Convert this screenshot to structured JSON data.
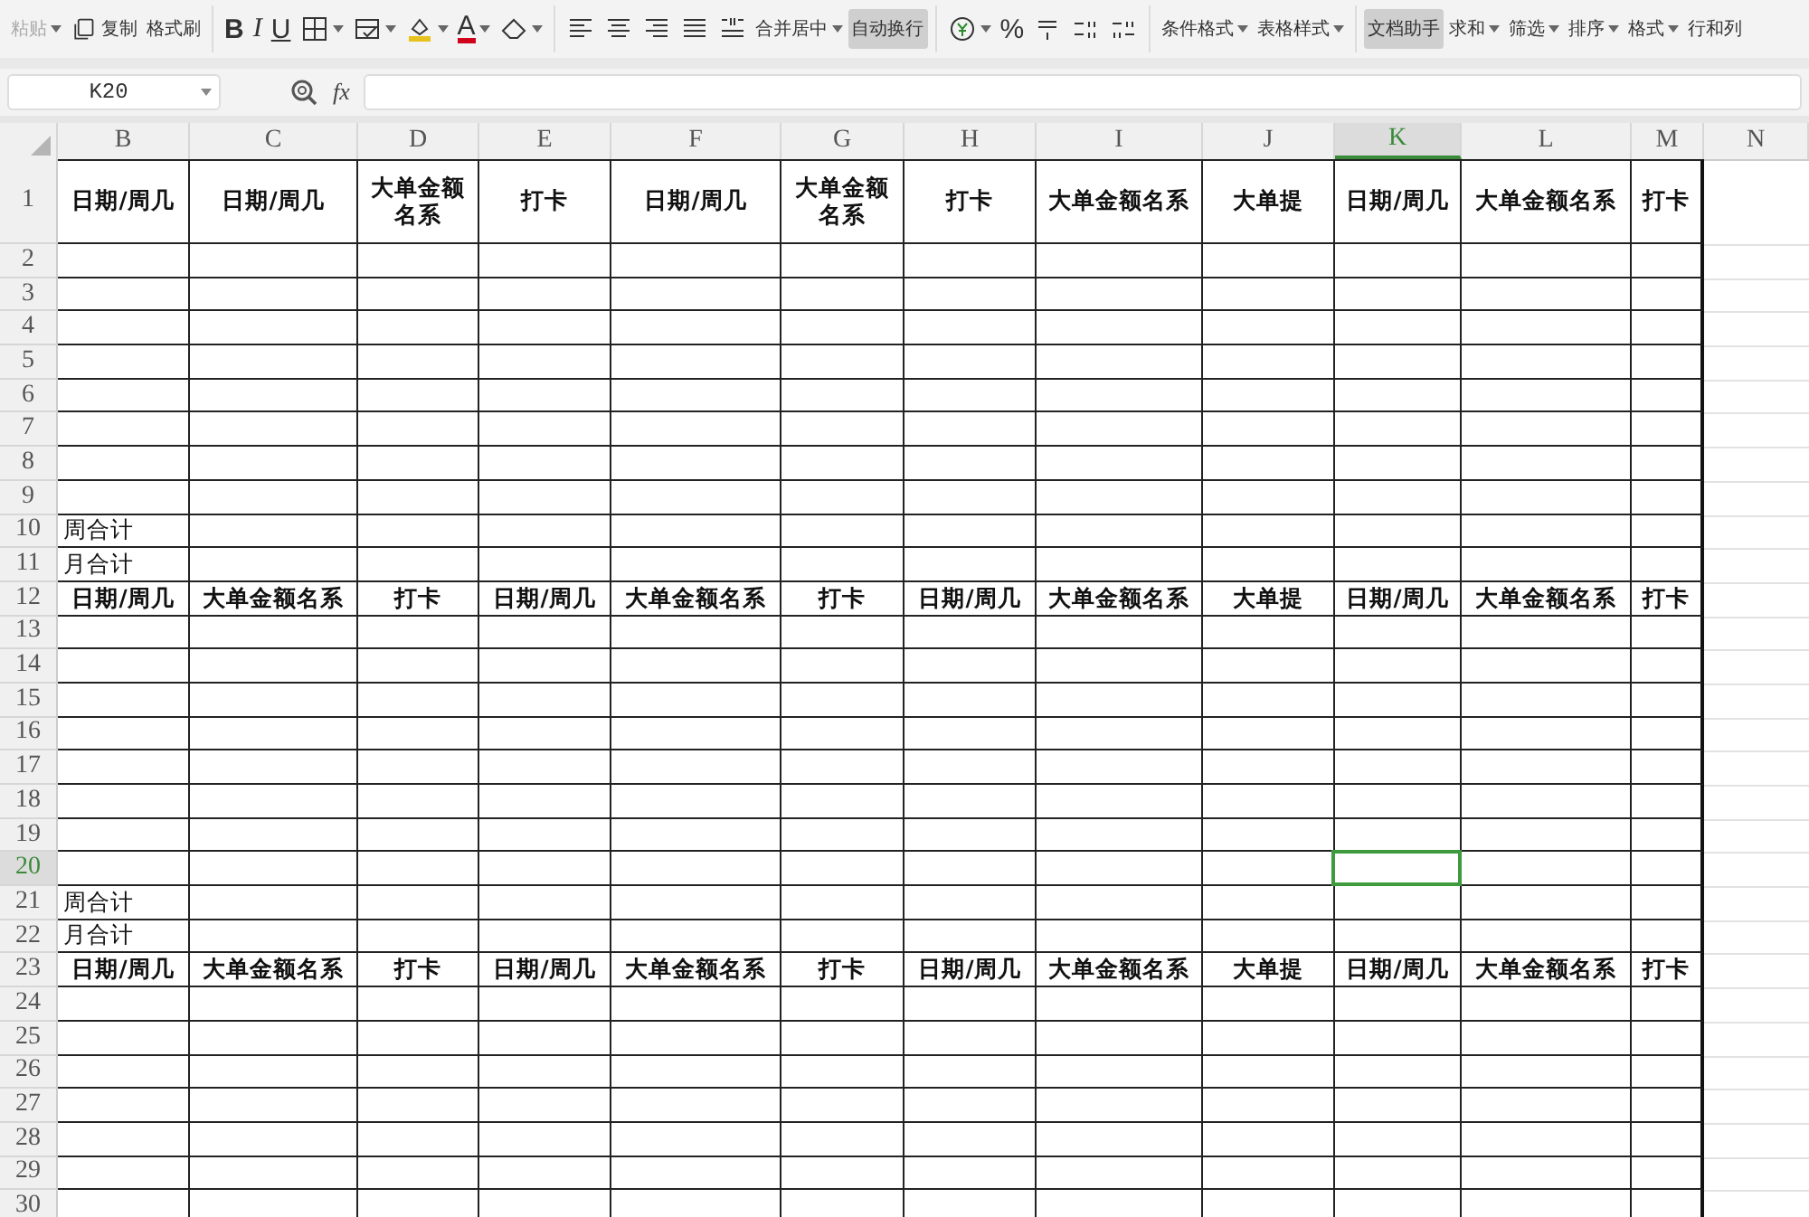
{
  "toolbar": [
    {
      "kind": "text",
      "label": "粘贴",
      "disabled": true,
      "active": false,
      "dropdown": true
    },
    {
      "kind": "copy",
      "label": "复制",
      "disabled": false,
      "active": false,
      "dropdown": false
    },
    {
      "kind": "text",
      "label": "格式刷",
      "disabled": false,
      "active": false,
      "dropdown": false
    },
    {
      "kind": "separator"
    },
    {
      "kind": "bold",
      "label": "B",
      "disabled": false,
      "active": false,
      "dropdown": false
    },
    {
      "kind": "italic",
      "label": "I",
      "disabled": false,
      "active": false,
      "dropdown": false
    },
    {
      "kind": "underline",
      "label": "U",
      "disabled": false,
      "active": false,
      "dropdown": false
    },
    {
      "kind": "borders",
      "disabled": false,
      "active": false,
      "dropdown": true
    },
    {
      "kind": "cell-format",
      "disabled": false,
      "active": false,
      "dropdown": true
    },
    {
      "kind": "fill",
      "disabled": false,
      "active": false,
      "dropdown": true
    },
    {
      "kind": "font-color",
      "label": "A",
      "disabled": false,
      "active": false,
      "dropdown": true
    },
    {
      "kind": "eraser",
      "disabled": false,
      "active": false,
      "dropdown": true
    },
    {
      "kind": "separator"
    },
    {
      "kind": "align-left",
      "disabled": false,
      "active": false,
      "dropdown": false
    },
    {
      "kind": "align-center",
      "disabled": false,
      "active": false,
      "dropdown": false
    },
    {
      "kind": "align-right",
      "disabled": false,
      "active": false,
      "dropdown": false
    },
    {
      "kind": "justify",
      "disabled": false,
      "active": false,
      "dropdown": false
    },
    {
      "kind": "distribute",
      "disabled": false,
      "active": false,
      "dropdown": false
    },
    {
      "kind": "text",
      "label": "合并居中",
      "disabled": false,
      "active": false,
      "dropdown": true
    },
    {
      "kind": "text",
      "label": "自动换行",
      "disabled": false,
      "active": true,
      "dropdown": false
    },
    {
      "kind": "separator"
    },
    {
      "kind": "currency",
      "disabled": false,
      "active": false,
      "dropdown": true
    },
    {
      "kind": "glyph",
      "label": "%",
      "disabled": false,
      "active": false,
      "dropdown": false
    },
    {
      "kind": "thousands",
      "disabled": false,
      "active": false,
      "dropdown": false
    },
    {
      "kind": "decimal-increase",
      "disabled": false,
      "active": false,
      "dropdown": false
    },
    {
      "kind": "decimal-decrease",
      "disabled": false,
      "active": false,
      "dropdown": false
    },
    {
      "kind": "separator"
    },
    {
      "kind": "text",
      "label": "条件格式",
      "disabled": false,
      "active": false,
      "dropdown": true
    },
    {
      "kind": "text",
      "label": "表格样式",
      "disabled": false,
      "active": false,
      "dropdown": true
    },
    {
      "kind": "separator"
    },
    {
      "kind": "text",
      "label": "文档助手",
      "disabled": false,
      "active": true,
      "dropdown": false
    },
    {
      "kind": "text",
      "label": "求和",
      "disabled": false,
      "active": false,
      "dropdown": true
    },
    {
      "kind": "text",
      "label": "筛选",
      "disabled": false,
      "active": false,
      "dropdown": true
    },
    {
      "kind": "text",
      "label": "排序",
      "disabled": false,
      "active": false,
      "dropdown": true
    },
    {
      "kind": "text",
      "label": "格式",
      "disabled": false,
      "active": false,
      "dropdown": true
    },
    {
      "kind": "text",
      "label": "行和列",
      "disabled": false,
      "active": false,
      "dropdown": false
    }
  ],
  "formula_bar": {
    "cell_name": "K20",
    "fx": "fx"
  },
  "sheet": {
    "columns": [
      {
        "label": "B",
        "selected": false
      },
      {
        "label": "C",
        "selected": false
      },
      {
        "label": "D",
        "selected": false
      },
      {
        "label": "E",
        "selected": false
      },
      {
        "label": "F",
        "selected": false
      },
      {
        "label": "G",
        "selected": false
      },
      {
        "label": "H",
        "selected": false
      },
      {
        "label": "I",
        "selected": false
      },
      {
        "label": "J",
        "selected": false
      },
      {
        "label": "K",
        "selected": true
      },
      {
        "label": "L",
        "selected": false
      },
      {
        "label": "M",
        "selected": false
      },
      {
        "label": "N",
        "selected": false
      }
    ],
    "rows": [
      {
        "number": "1",
        "kind": "tall-header",
        "selected": false,
        "cells": [
          "日期/周几",
          "日期/周几",
          "大单金额名系",
          "打卡",
          "日期/周几",
          "大单金额名系",
          "打卡",
          "大单金额名系",
          "大单提",
          "日期/周几",
          "大单金额名系",
          "打卡"
        ]
      },
      {
        "number": "2",
        "kind": "blank",
        "selected": false
      },
      {
        "number": "3",
        "kind": "blank",
        "selected": false
      },
      {
        "number": "4",
        "kind": "blank",
        "selected": false
      },
      {
        "number": "5",
        "kind": "blank",
        "selected": false
      },
      {
        "number": "6",
        "kind": "blank",
        "selected": false
      },
      {
        "number": "7",
        "kind": "blank",
        "selected": false
      },
      {
        "number": "8",
        "kind": "blank",
        "selected": false
      },
      {
        "number": "9",
        "kind": "blank",
        "selected": false
      },
      {
        "number": "10",
        "kind": "total",
        "selected": false,
        "label": "周合计"
      },
      {
        "number": "11",
        "kind": "total",
        "selected": false,
        "label": "月合计"
      },
      {
        "number": "12",
        "kind": "header",
        "selected": false,
        "cells": [
          "日期/周几",
          "大单金额名系",
          "打卡",
          "日期/周几",
          "大单金额名系",
          "打卡",
          "日期/周几",
          "大单金额名系",
          "大单提",
          "日期/周几",
          "大单金额名系",
          "打卡"
        ]
      },
      {
        "number": "13",
        "kind": "blank",
        "selected": false
      },
      {
        "number": "14",
        "kind": "blank",
        "selected": false
      },
      {
        "number": "15",
        "kind": "blank",
        "selected": false
      },
      {
        "number": "16",
        "kind": "blank",
        "selected": false
      },
      {
        "number": "17",
        "kind": "blank",
        "selected": false
      },
      {
        "number": "18",
        "kind": "blank",
        "selected": false
      },
      {
        "number": "19",
        "kind": "blank",
        "selected": false
      },
      {
        "number": "20",
        "kind": "blank",
        "selected": true
      },
      {
        "number": "21",
        "kind": "total",
        "selected": false,
        "label": "周合计"
      },
      {
        "number": "22",
        "kind": "total",
        "selected": false,
        "label": "月合计"
      },
      {
        "number": "23",
        "kind": "header",
        "selected": false,
        "cells": [
          "日期/周几",
          "大单金额名系",
          "打卡",
          "日期/周几",
          "大单金额名系",
          "打卡",
          "日期/周几",
          "大单金额名系",
          "大单提",
          "日期/周几",
          "大单金额名系",
          "打卡"
        ]
      },
      {
        "number": "24",
        "kind": "blank",
        "selected": false
      },
      {
        "number": "25",
        "kind": "blank",
        "selected": false
      },
      {
        "number": "26",
        "kind": "blank",
        "selected": false
      },
      {
        "number": "27",
        "kind": "blank",
        "selected": false
      },
      {
        "number": "28",
        "kind": "blank",
        "selected": false
      },
      {
        "number": "29",
        "kind": "blank",
        "selected": false
      },
      {
        "number": "30",
        "kind": "blank",
        "selected": false
      }
    ]
  }
}
